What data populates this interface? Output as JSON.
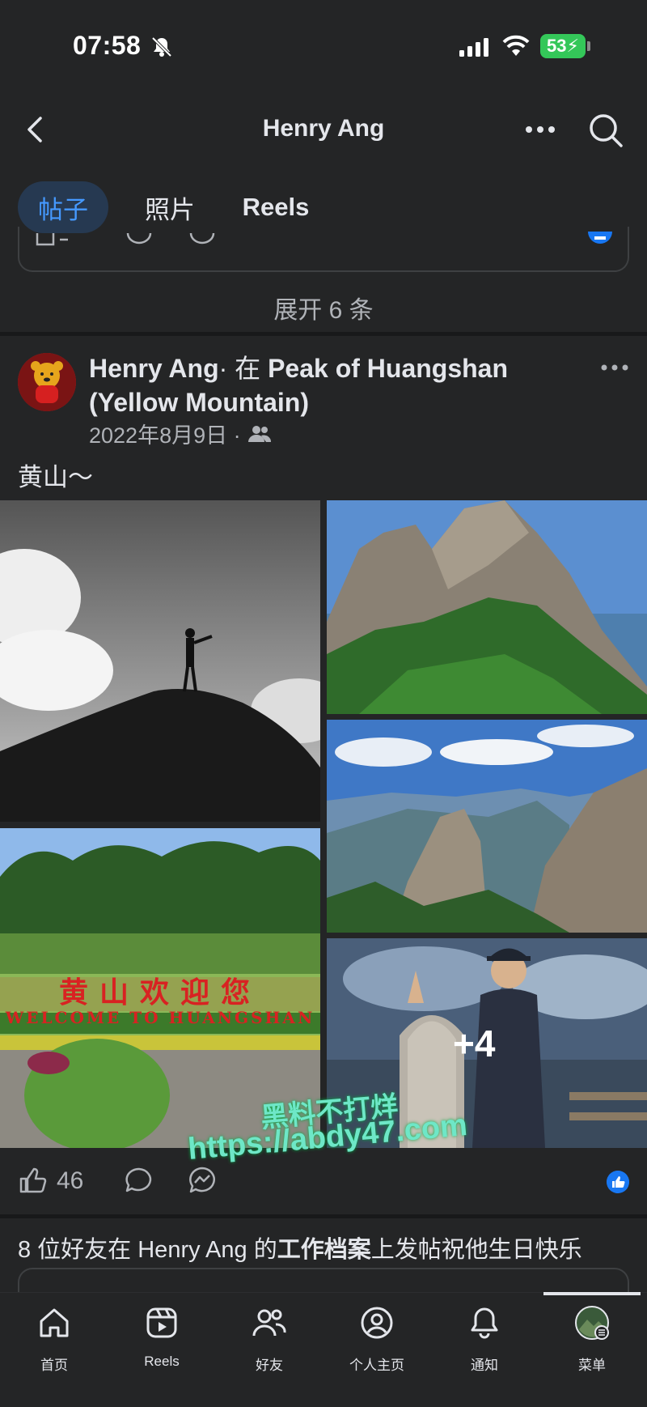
{
  "status_bar": {
    "time": "07:58",
    "battery": "53"
  },
  "header": {
    "title": "Henry Ang"
  },
  "tabs": [
    {
      "label": "帖子",
      "active": true
    },
    {
      "label": "照片",
      "active": false
    },
    {
      "label": "Reels",
      "active": false
    }
  ],
  "expand": {
    "label": "展开 6 条"
  },
  "post": {
    "author": "Henry Ang",
    "location_prefix": "· 在 ",
    "location": "Peak of Huangshan (Yellow Mountain)",
    "date": "2022年8月9日 ·",
    "text": "黄山～",
    "more_photos": "+4",
    "photo_sign_top": "黄山欢迎您",
    "photo_sign_bottom": "WELCOME TO HUANGSHAN",
    "watermark_line1": "黑料不打烊",
    "watermark_line2": "https://abdy47.com",
    "like_count": "46"
  },
  "birthday": {
    "text_prefix": "8 位好友在 Henry Ang 的",
    "text_bold": "工作档案",
    "text_suffix": "上发帖祝他生日快乐"
  },
  "bottom_nav": [
    {
      "label": "首页",
      "icon": "home-icon"
    },
    {
      "label": "Reels",
      "icon": "reels-icon"
    },
    {
      "label": "好友",
      "icon": "friends-icon"
    },
    {
      "label": "个人主页",
      "icon": "profile-icon"
    },
    {
      "label": "通知",
      "icon": "bell-icon"
    },
    {
      "label": "菜单",
      "icon": "menu-avatar-icon"
    }
  ],
  "colors": {
    "accent": "#4599ff",
    "background": "#242526",
    "like_blue": "#1877f2",
    "battery_green": "#34c759"
  }
}
